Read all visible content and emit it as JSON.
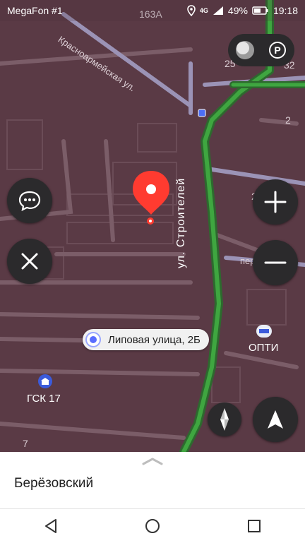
{
  "statusbar": {
    "carrier": "MegaFon #1",
    "network": "4G",
    "battery": "49%",
    "time": "19:18"
  },
  "map": {
    "labels": {
      "house_163a": "163А",
      "street_krasnoarmeyskaya": "Красноармейская ул.",
      "street_stroiteley": "ул. Строителей",
      "per": "пер.",
      "num_25_top": "25",
      "num_32": "32",
      "num_2": "2",
      "num_25_mid": "25",
      "num_7": "7"
    },
    "pois": {
      "opti": "ОПТИ",
      "gsk": "ГСК 17"
    },
    "address_pill": "Липовая улица, 2Б"
  },
  "controls": {
    "parking_icon_text": "P"
  },
  "bottom_sheet": {
    "title": "Берёзовский"
  },
  "colors": {
    "map_bg": "#5a3a45",
    "route_green": "#3fa640",
    "pin_red": "#ff3b30",
    "button_dark": "#2b2a2c"
  }
}
